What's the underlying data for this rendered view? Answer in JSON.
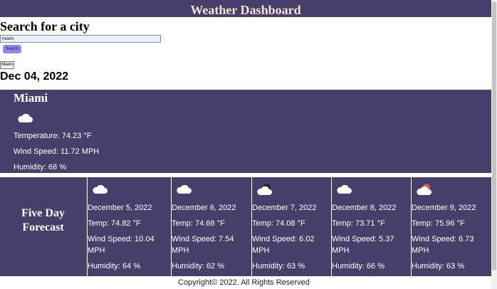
{
  "header": {
    "title": "Weather Dashboard"
  },
  "search": {
    "title": "Search for a city",
    "input_value": "miami",
    "button_label": "Search",
    "history": [
      "Miami"
    ]
  },
  "today": {
    "date": "Dec 04, 2022",
    "city": "Miami",
    "icon": "cloud-icon",
    "temperature": "Temperature: 74.23 °F",
    "wind": "Wind Speed: 11.72 MPH",
    "humidity": "Humidity: 68 %"
  },
  "forecast": {
    "title": "Five Day Forecast",
    "days": [
      {
        "date": "December 5, 2022",
        "icon": "cloud-icon",
        "temp": "Temp: 74.82 °F",
        "wind": "Wind Speed: 10.04 MPH",
        "humidity": "Humidity: 64 %"
      },
      {
        "date": "December 6, 2022",
        "icon": "cloud-icon",
        "temp": "Temp: 74.68 °F",
        "wind": "Wind Speed: 7.54 MPH",
        "humidity": "Humidity: 62 %"
      },
      {
        "date": "December 7, 2022",
        "icon": "cloud-night-icon",
        "temp": "Temp: 74.08 °F",
        "wind": "Wind Speed: 6.02 MPH",
        "humidity": "Humidity: 63 %"
      },
      {
        "date": "December 8, 2022",
        "icon": "cloud-icon",
        "temp": "Temp: 73.71 °F",
        "wind": "Wind Speed: 5.37 MPH",
        "humidity": "Humidity: 66 %"
      },
      {
        "date": "December 9, 2022",
        "icon": "cloud-sun-icon",
        "temp": "Temp: 75.96 °F",
        "wind": "Wind Speed: 6.73 MPH",
        "humidity": "Humidity: 63 %"
      }
    ]
  },
  "footer": {
    "text": "Copyright© 2022. All Rights Reserved"
  },
  "colors": {
    "panel": "#463f6a",
    "header_text": "#f3e1d3",
    "search_button": "#8f89ea"
  }
}
